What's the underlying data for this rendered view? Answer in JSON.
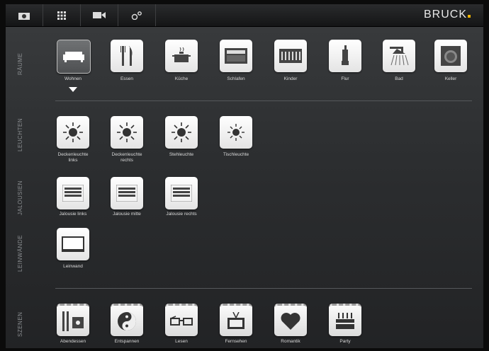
{
  "brand": "BRUCK",
  "brand_accent": "#f0b400",
  "toolbar": [
    "camera-icon",
    "grid-icon",
    "video-icon",
    "link-icon"
  ],
  "sections": {
    "raeume": "RÄUME",
    "leuchten": "LEUCHTEN",
    "jalousien": "JALOUSIEN",
    "leinwaende": "LEINWÄNDE",
    "szenen": "SZENEN"
  },
  "rooms": [
    "Wohnen",
    "Essen",
    "Küche",
    "Schlafen",
    "Kinder",
    "Flur",
    "Bad",
    "Keller"
  ],
  "selected_room": "Wohnen",
  "lights": [
    "Deckenleuchte\nlinks",
    "Deckenleuchte\nrechts",
    "Stehleuchte",
    "Tischleuchte"
  ],
  "blinds": [
    "Jalousie links",
    "Jalousie mitte",
    "Jalousie rechts"
  ],
  "screens": [
    "Leinwand"
  ],
  "scenes": [
    "Abendessen",
    "Entspannen",
    "Lesen",
    "Fernsehen",
    "Romantik",
    "Party"
  ]
}
